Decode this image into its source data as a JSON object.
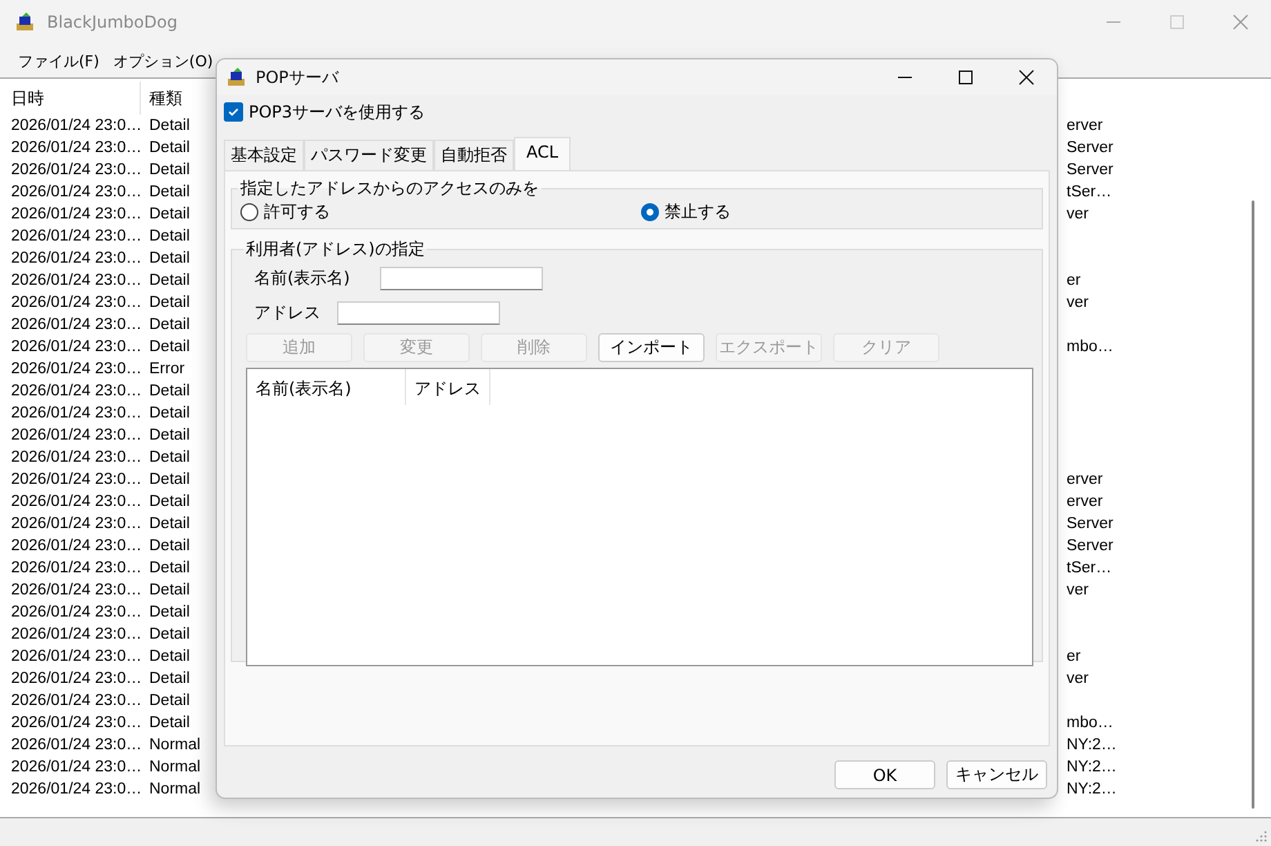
{
  "main_window": {
    "title": "BlackJumboDog",
    "menu": [
      "ファイル(F)",
      "オプション(O)"
    ],
    "log": {
      "columns": [
        "日時",
        "種類"
      ],
      "rows": [
        {
          "date": "2026/01/24 23:0…",
          "category": "Detail",
          "column_3": "erver"
        },
        {
          "date": "2026/01/24 23:0…",
          "category": "Detail",
          "column_3": "Server"
        },
        {
          "date": "2026/01/24 23:0…",
          "category": "Detail",
          "column_3": "Server"
        },
        {
          "date": "2026/01/24 23:0…",
          "category": "Detail",
          "column_3": "tSer…"
        },
        {
          "date": "2026/01/24 23:0…",
          "category": "Detail",
          "column_3": "ver"
        },
        {
          "date": "2026/01/24 23:0…",
          "category": "Detail"
        },
        {
          "date": "2026/01/24 23:0…",
          "category": "Detail"
        },
        {
          "date": "2026/01/24 23:0…",
          "category": "Detail",
          "column_3": "er"
        },
        {
          "date": "2026/01/24 23:0…",
          "category": "Detail",
          "column_3": "ver"
        },
        {
          "date": "2026/01/24 23:0…",
          "category": "Detail"
        },
        {
          "date": "2026/01/24 23:0…",
          "category": "Detail",
          "column_3": "mbo…"
        },
        {
          "date": "2026/01/24 23:0…",
          "category": "Error"
        },
        {
          "date": "2026/01/24 23:0…",
          "category": "Detail"
        },
        {
          "date": "2026/01/24 23:0…",
          "category": "Detail"
        },
        {
          "date": "2026/01/24 23:0…",
          "category": "Detail"
        },
        {
          "date": "2026/01/24 23:0…",
          "category": "Detail"
        },
        {
          "date": "2026/01/24 23:0…",
          "category": "Detail",
          "column_3": "erver"
        },
        {
          "date": "2026/01/24 23:0…",
          "category": "Detail",
          "column_3": "erver"
        },
        {
          "date": "2026/01/24 23:0…",
          "category": "Detail",
          "column_3": "Server"
        },
        {
          "date": "2026/01/24 23:0…",
          "category": "Detail",
          "column_3": "Server"
        },
        {
          "date": "2026/01/24 23:0…",
          "category": "Detail",
          "column_3": "tSer…"
        },
        {
          "date": "2026/01/24 23:0…",
          "category": "Detail",
          "column_3": "ver"
        },
        {
          "date": "2026/01/24 23:0…",
          "category": "Detail"
        },
        {
          "date": "2026/01/24 23:0…",
          "category": "Detail"
        },
        {
          "date": "2026/01/24 23:0…",
          "category": "Detail",
          "column_3": "er"
        },
        {
          "date": "2026/01/24 23:0…",
          "category": "Detail",
          "column_3": "ver"
        },
        {
          "date": "2026/01/24 23:0…",
          "category": "Detail"
        },
        {
          "date": "2026/01/24 23:0…",
          "category": "Detail",
          "column_3": "mbo…"
        },
        {
          "date": "2026/01/24 23:0…",
          "category": "Normal",
          "column_3": "NY:2…"
        },
        {
          "date": "2026/01/24 23:0…",
          "category": "Normal",
          "column_3": "NY:2…"
        },
        {
          "date": "2026/01/24 23:0…",
          "category": "Normal",
          "column_3": "NY:2…"
        }
      ]
    }
  },
  "dialog": {
    "title": "POPサーバ",
    "enable_checkbox": {
      "label": "POP3サーバを使用する",
      "checked": true
    },
    "tabs": [
      {
        "label": "基本設定",
        "selected": false
      },
      {
        "label": "パスワード変更",
        "selected": false
      },
      {
        "label": "自動拒否",
        "selected": false
      },
      {
        "label": "ACL",
        "selected": true
      }
    ],
    "access_group": {
      "title": "指定したアドレスからのアクセスのみを",
      "options": [
        {
          "label": "許可する",
          "selected": false
        },
        {
          "label": "禁止する",
          "selected": true
        }
      ]
    },
    "user_group": {
      "title": "利用者(アドレス)の指定",
      "name_label": "名前(表示名)",
      "address_label": "アドレス",
      "buttons": [
        {
          "label": "追加",
          "disabled": true
        },
        {
          "label": "変更",
          "disabled": true
        },
        {
          "label": "削除",
          "disabled": true
        },
        {
          "label": "インポート",
          "disabled": false
        },
        {
          "label": "エクスポート",
          "disabled": true
        },
        {
          "label": "クリア",
          "disabled": true
        }
      ],
      "list_columns": [
        "名前(表示名)",
        "アドレス"
      ]
    },
    "buttons": [
      "OK",
      "キャンセル"
    ]
  }
}
